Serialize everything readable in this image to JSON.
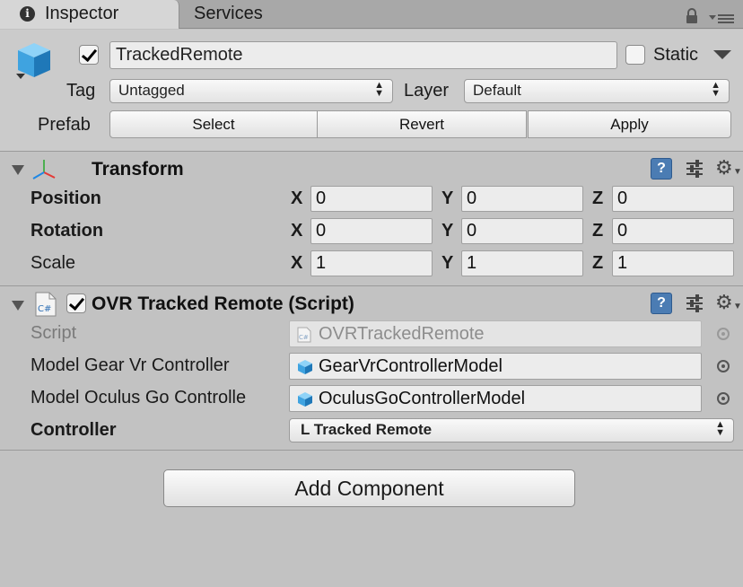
{
  "tabs": [
    {
      "label": "Inspector",
      "icon": "info-icon",
      "active": true
    },
    {
      "label": "Services",
      "active": false
    }
  ],
  "header": {
    "object_icon": "cube-icon",
    "active": true,
    "name": "TrackedRemote",
    "static_label": "Static",
    "static_checked": false,
    "tag_label": "Tag",
    "tag_value": "Untagged",
    "layer_label": "Layer",
    "layer_value": "Default",
    "prefab_label": "Prefab",
    "prefab_buttons": [
      "Select",
      "Revert",
      "Apply"
    ]
  },
  "transform": {
    "title": "Transform",
    "rows": [
      {
        "label": "Position",
        "x": "0",
        "y": "0",
        "z": "0",
        "bold": true
      },
      {
        "label": "Rotation",
        "x": "0",
        "y": "0",
        "z": "0",
        "bold": true
      },
      {
        "label": "Scale",
        "x": "1",
        "y": "1",
        "z": "1",
        "bold": false
      }
    ],
    "axis_labels": [
      "X",
      "Y",
      "Z"
    ]
  },
  "script_component": {
    "title": "OVR Tracked Remote (Script)",
    "enabled": true,
    "fields": [
      {
        "label": "Script",
        "value": "OVRTrackedRemote",
        "type": "script"
      },
      {
        "label": "Model Gear Vr Controller",
        "value": "GearVrControllerModel",
        "type": "object"
      },
      {
        "label": "Model Oculus Go Controlle",
        "value": "OculusGoControllerModel",
        "type": "object"
      }
    ],
    "controller_label": "Controller",
    "controller_value": "L Tracked Remote"
  },
  "add_component_label": "Add Component",
  "colors": {
    "panel": "#c2c2c2",
    "header": "#cbcbcb",
    "help_blue": "#4b7cb3",
    "cube_blue": "#3fa3e0"
  }
}
